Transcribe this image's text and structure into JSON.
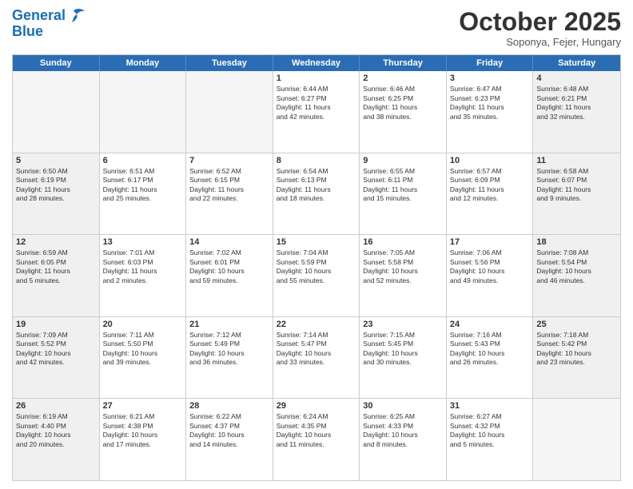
{
  "header": {
    "logo_line1": "General",
    "logo_line2": "Blue",
    "month": "October 2025",
    "location": "Soponya, Fejer, Hungary"
  },
  "days_of_week": [
    "Sunday",
    "Monday",
    "Tuesday",
    "Wednesday",
    "Thursday",
    "Friday",
    "Saturday"
  ],
  "weeks": [
    [
      {
        "day": "",
        "text": "",
        "empty": true
      },
      {
        "day": "",
        "text": "",
        "empty": true
      },
      {
        "day": "",
        "text": "",
        "empty": true
      },
      {
        "day": "1",
        "text": "Sunrise: 6:44 AM\nSunset: 6:27 PM\nDaylight: 11 hours\nand 42 minutes.",
        "empty": false
      },
      {
        "day": "2",
        "text": "Sunrise: 6:46 AM\nSunset: 6:25 PM\nDaylight: 11 hours\nand 38 minutes.",
        "empty": false
      },
      {
        "day": "3",
        "text": "Sunrise: 6:47 AM\nSunset: 6:23 PM\nDaylight: 11 hours\nand 35 minutes.",
        "empty": false
      },
      {
        "day": "4",
        "text": "Sunrise: 6:48 AM\nSunset: 6:21 PM\nDaylight: 11 hours\nand 32 minutes.",
        "empty": false,
        "shaded": true
      }
    ],
    [
      {
        "day": "5",
        "text": "Sunrise: 6:50 AM\nSunset: 6:19 PM\nDaylight: 11 hours\nand 28 minutes.",
        "empty": false,
        "shaded": true
      },
      {
        "day": "6",
        "text": "Sunrise: 6:51 AM\nSunset: 6:17 PM\nDaylight: 11 hours\nand 25 minutes.",
        "empty": false
      },
      {
        "day": "7",
        "text": "Sunrise: 6:52 AM\nSunset: 6:15 PM\nDaylight: 11 hours\nand 22 minutes.",
        "empty": false
      },
      {
        "day": "8",
        "text": "Sunrise: 6:54 AM\nSunset: 6:13 PM\nDaylight: 11 hours\nand 18 minutes.",
        "empty": false
      },
      {
        "day": "9",
        "text": "Sunrise: 6:55 AM\nSunset: 6:11 PM\nDaylight: 11 hours\nand 15 minutes.",
        "empty": false
      },
      {
        "day": "10",
        "text": "Sunrise: 6:57 AM\nSunset: 6:09 PM\nDaylight: 11 hours\nand 12 minutes.",
        "empty": false
      },
      {
        "day": "11",
        "text": "Sunrise: 6:58 AM\nSunset: 6:07 PM\nDaylight: 11 hours\nand 9 minutes.",
        "empty": false,
        "shaded": true
      }
    ],
    [
      {
        "day": "12",
        "text": "Sunrise: 6:59 AM\nSunset: 6:05 PM\nDaylight: 11 hours\nand 5 minutes.",
        "empty": false,
        "shaded": true
      },
      {
        "day": "13",
        "text": "Sunrise: 7:01 AM\nSunset: 6:03 PM\nDaylight: 11 hours\nand 2 minutes.",
        "empty": false
      },
      {
        "day": "14",
        "text": "Sunrise: 7:02 AM\nSunset: 6:01 PM\nDaylight: 10 hours\nand 59 minutes.",
        "empty": false
      },
      {
        "day": "15",
        "text": "Sunrise: 7:04 AM\nSunset: 5:59 PM\nDaylight: 10 hours\nand 55 minutes.",
        "empty": false
      },
      {
        "day": "16",
        "text": "Sunrise: 7:05 AM\nSunset: 5:58 PM\nDaylight: 10 hours\nand 52 minutes.",
        "empty": false
      },
      {
        "day": "17",
        "text": "Sunrise: 7:06 AM\nSunset: 5:56 PM\nDaylight: 10 hours\nand 49 minutes.",
        "empty": false
      },
      {
        "day": "18",
        "text": "Sunrise: 7:08 AM\nSunset: 5:54 PM\nDaylight: 10 hours\nand 46 minutes.",
        "empty": false,
        "shaded": true
      }
    ],
    [
      {
        "day": "19",
        "text": "Sunrise: 7:09 AM\nSunset: 5:52 PM\nDaylight: 10 hours\nand 42 minutes.",
        "empty": false,
        "shaded": true
      },
      {
        "day": "20",
        "text": "Sunrise: 7:11 AM\nSunset: 5:50 PM\nDaylight: 10 hours\nand 39 minutes.",
        "empty": false
      },
      {
        "day": "21",
        "text": "Sunrise: 7:12 AM\nSunset: 5:49 PM\nDaylight: 10 hours\nand 36 minutes.",
        "empty": false
      },
      {
        "day": "22",
        "text": "Sunrise: 7:14 AM\nSunset: 5:47 PM\nDaylight: 10 hours\nand 33 minutes.",
        "empty": false
      },
      {
        "day": "23",
        "text": "Sunrise: 7:15 AM\nSunset: 5:45 PM\nDaylight: 10 hours\nand 30 minutes.",
        "empty": false
      },
      {
        "day": "24",
        "text": "Sunrise: 7:16 AM\nSunset: 5:43 PM\nDaylight: 10 hours\nand 26 minutes.",
        "empty": false
      },
      {
        "day": "25",
        "text": "Sunrise: 7:18 AM\nSunset: 5:42 PM\nDaylight: 10 hours\nand 23 minutes.",
        "empty": false,
        "shaded": true
      }
    ],
    [
      {
        "day": "26",
        "text": "Sunrise: 6:19 AM\nSunset: 4:40 PM\nDaylight: 10 hours\nand 20 minutes.",
        "empty": false,
        "shaded": true
      },
      {
        "day": "27",
        "text": "Sunrise: 6:21 AM\nSunset: 4:38 PM\nDaylight: 10 hours\nand 17 minutes.",
        "empty": false
      },
      {
        "day": "28",
        "text": "Sunrise: 6:22 AM\nSunset: 4:37 PM\nDaylight: 10 hours\nand 14 minutes.",
        "empty": false
      },
      {
        "day": "29",
        "text": "Sunrise: 6:24 AM\nSunset: 4:35 PM\nDaylight: 10 hours\nand 11 minutes.",
        "empty": false
      },
      {
        "day": "30",
        "text": "Sunrise: 6:25 AM\nSunset: 4:33 PM\nDaylight: 10 hours\nand 8 minutes.",
        "empty": false
      },
      {
        "day": "31",
        "text": "Sunrise: 6:27 AM\nSunset: 4:32 PM\nDaylight: 10 hours\nand 5 minutes.",
        "empty": false
      },
      {
        "day": "",
        "text": "",
        "empty": true,
        "shaded": true
      }
    ]
  ]
}
